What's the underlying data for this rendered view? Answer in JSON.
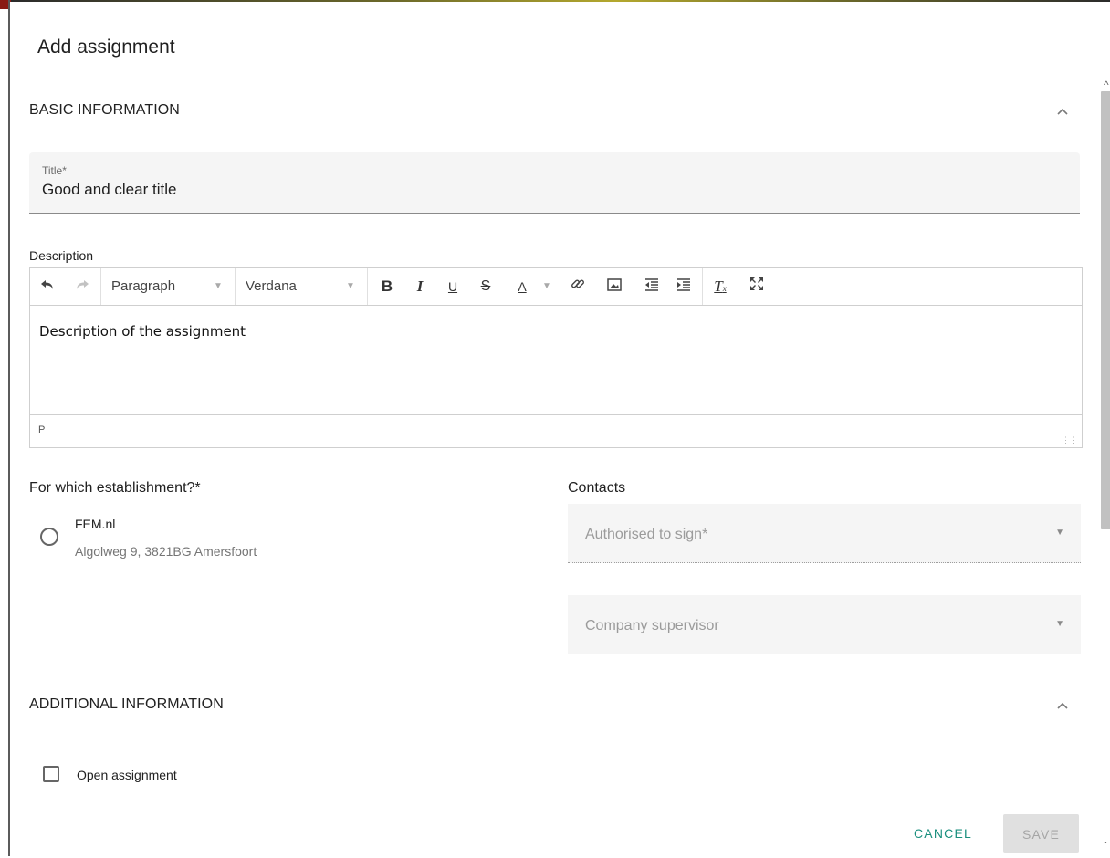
{
  "dialog": {
    "title": "Add assignment",
    "save_label": "SAVE",
    "cancel_label": "CANCEL"
  },
  "basic": {
    "heading": "BASIC INFORMATION",
    "title_label": "Title*",
    "title_value": "Good and clear title",
    "description_label": "Description"
  },
  "editor": {
    "paragraph_format": "Paragraph",
    "font_family": "Verdana",
    "content": "Description of the assignment",
    "status_path": "P"
  },
  "establishment": {
    "label": "For which establishment?*",
    "options": [
      {
        "name": "FEM.nl",
        "address": "Algolweg 9, 3821BG Amersfoort",
        "selected": false
      }
    ]
  },
  "contacts": {
    "label": "Contacts",
    "authorised_placeholder": "Authorised to sign*",
    "supervisor_placeholder": "Company supervisor"
  },
  "additional": {
    "heading": "ADDITIONAL INFORMATION",
    "open_assignment_label": "Open assignment",
    "open_assignment_checked": false
  },
  "colors": {
    "accent": "#1a8f7e",
    "field_bg": "#f5f5f5",
    "disabled_bg": "#e0e0e0"
  },
  "icons": [
    "undo-icon",
    "redo-icon",
    "bold-icon",
    "italic-icon",
    "underline-icon",
    "strikethrough-icon",
    "font-color-icon",
    "link-icon",
    "image-icon",
    "outdent-icon",
    "indent-icon",
    "clear-formatting-icon",
    "fullscreen-icon",
    "chevron-up-icon",
    "dropdown-arrow-icon"
  ]
}
